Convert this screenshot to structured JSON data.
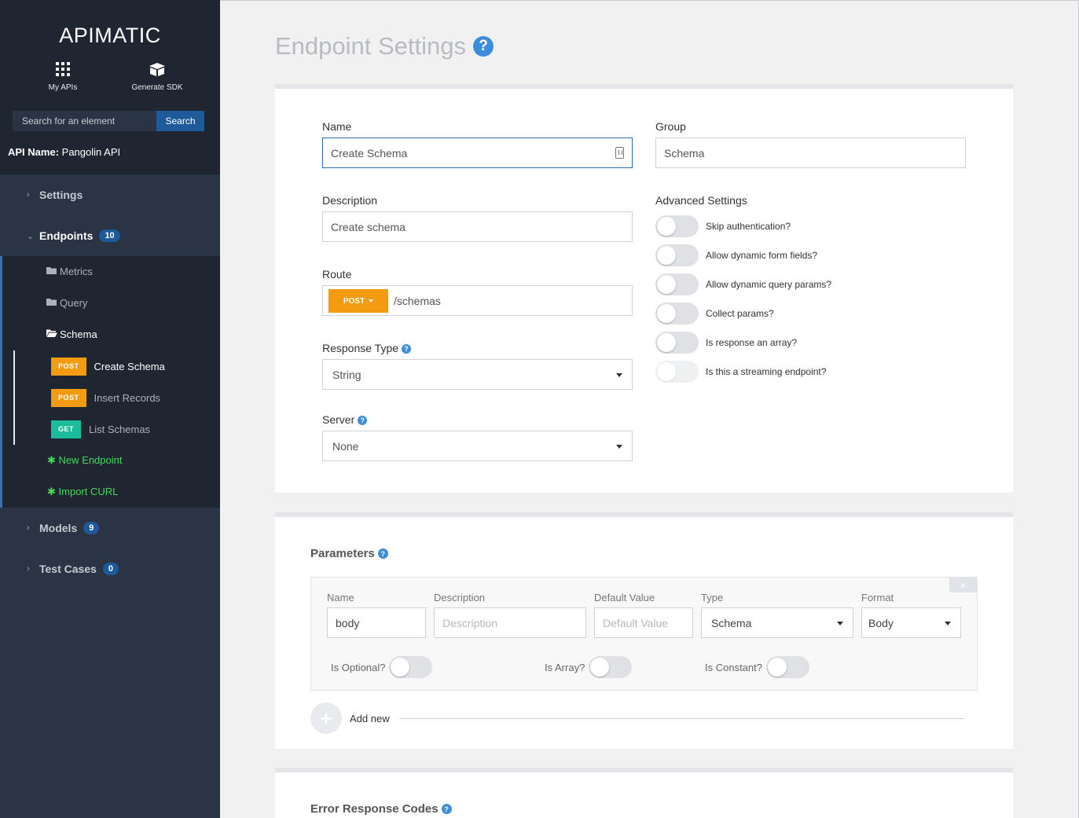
{
  "sidebar": {
    "brand": "APIMATIC",
    "actions": [
      {
        "label": "My APIs",
        "icon": "grid-icon"
      },
      {
        "label": "Generate SDK",
        "icon": "box-icon"
      }
    ],
    "search": {
      "placeholder": "Search for an element",
      "button": "Search"
    },
    "api_name_label": "API Name:",
    "api_name_value": "Pangolin API",
    "sections": {
      "settings": {
        "label": "Settings"
      },
      "endpoints": {
        "label": "Endpoints",
        "count": "10"
      },
      "models": {
        "label": "Models",
        "count": "9"
      },
      "test_cases": {
        "label": "Test Cases",
        "count": "0"
      }
    },
    "folders": [
      {
        "label": "Metrics"
      },
      {
        "label": "Query"
      },
      {
        "label": "Schema"
      }
    ],
    "endpoints": [
      {
        "method": "POST",
        "label": "Create Schema"
      },
      {
        "method": "POST",
        "label": "Insert Records"
      },
      {
        "method": "GET",
        "label": "List Schemas"
      }
    ],
    "links": {
      "new_endpoint": "New Endpoint",
      "import_curl": "Import CURL"
    }
  },
  "main": {
    "title": "Endpoint Settings",
    "name": {
      "label": "Name",
      "value": "Create Schema"
    },
    "group": {
      "label": "Group",
      "value": "Schema"
    },
    "description": {
      "label": "Description",
      "value": "Create schema"
    },
    "route": {
      "label": "Route",
      "method": "POST",
      "value": "/schemas"
    },
    "response_type": {
      "label": "Response Type",
      "value": "String"
    },
    "server": {
      "label": "Server",
      "value": "None"
    },
    "advanced": {
      "label": "Advanced Settings",
      "options": [
        {
          "label": "Skip authentication?"
        },
        {
          "label": "Allow dynamic form fields?"
        },
        {
          "label": "Allow dynamic query params?"
        },
        {
          "label": "Collect params?"
        },
        {
          "label": "Is response an array?"
        },
        {
          "label": "Is this a streaming endpoint?"
        }
      ]
    },
    "parameters": {
      "title": "Parameters",
      "close": "×",
      "columns": {
        "name": "Name",
        "description": "Description",
        "default": "Default Value",
        "type": "Type",
        "format": "Format"
      },
      "row": {
        "name": "body",
        "description_placeholder": "Description",
        "default_placeholder": "Default Value",
        "type": "Schema",
        "format": "Body"
      },
      "toggles": {
        "optional": "Is Optional?",
        "array": "Is Array?",
        "constant": "Is Constant?"
      },
      "add_new": "Add new"
    },
    "error_codes": {
      "title": "Error Response Codes"
    }
  }
}
